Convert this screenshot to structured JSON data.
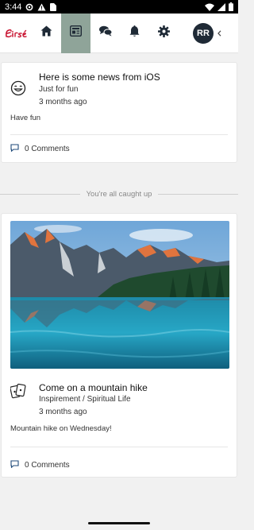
{
  "status_bar": {
    "time": "3:44"
  },
  "nav": {
    "items": [
      {
        "name": "home-icon"
      },
      {
        "name": "newspaper-icon"
      },
      {
        "name": "chat-icon"
      },
      {
        "name": "bell-icon"
      },
      {
        "name": "gear-icon"
      }
    ],
    "active_index": 1,
    "avatar_initials": "RR",
    "colors": {
      "active_bg": "#8fa499",
      "avatar_bg": "#1f2a36",
      "logo_red": "#c8102e"
    }
  },
  "feed": {
    "posts": [
      {
        "title": "Here is some news from iOS",
        "category": "Just for fun",
        "time": "3 months ago",
        "body": "Have fun",
        "comments": "0 Comments",
        "icon": "smiley-icon"
      },
      {
        "title": "Come on a mountain hike",
        "category": "Inspirement / Spiritual Life",
        "time": "3 months ago",
        "body": "Mountain hike on Wednesday!",
        "comments": "0 Comments",
        "icon": "cards-icon"
      }
    ],
    "caught_up": "You're all caught up"
  }
}
